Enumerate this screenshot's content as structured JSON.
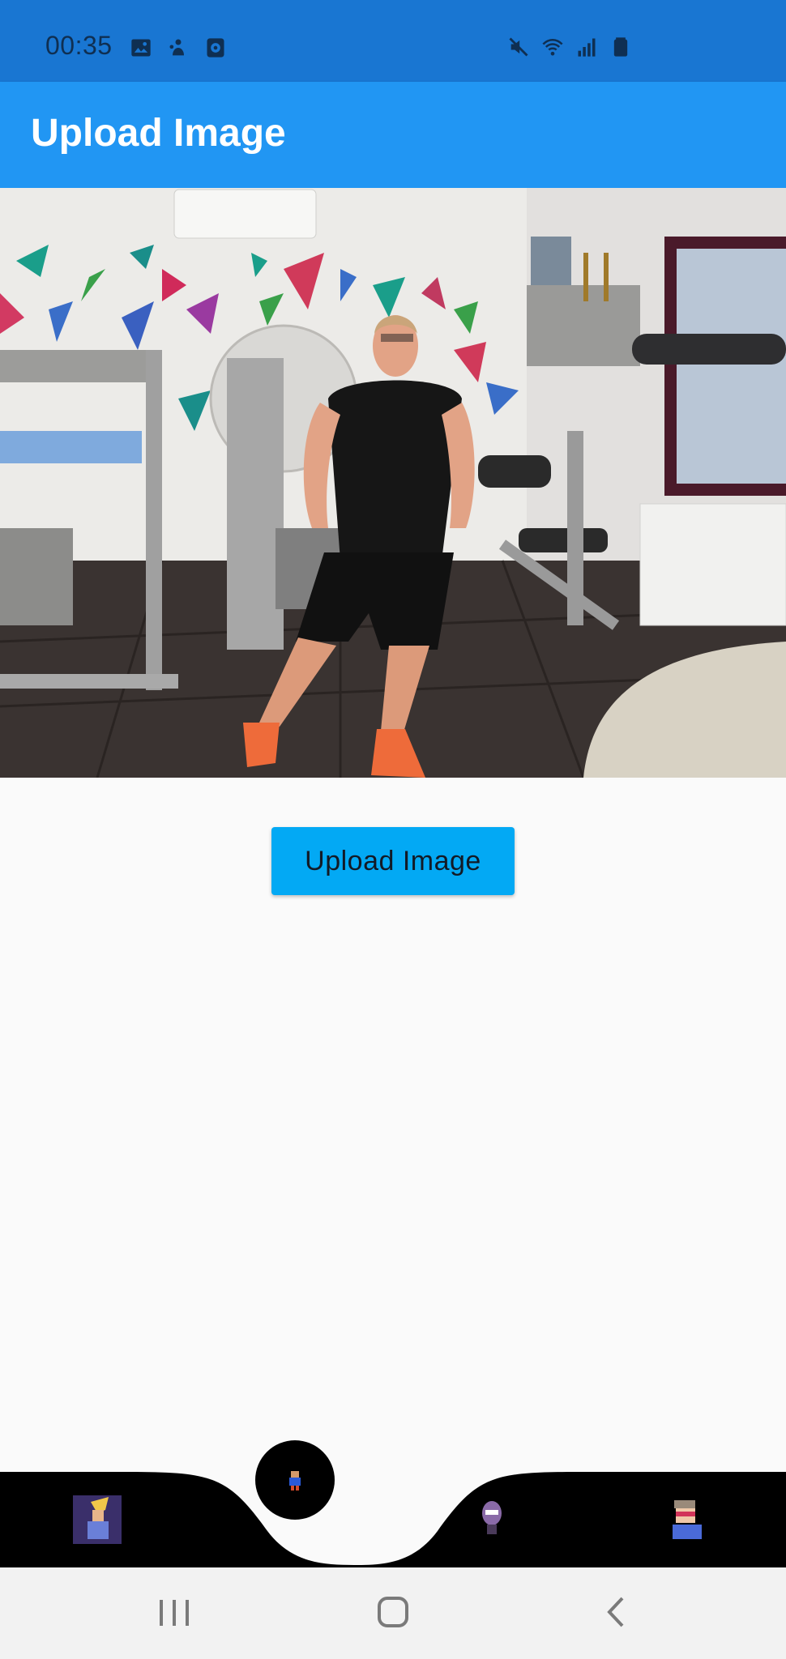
{
  "status_bar": {
    "time": "00:35",
    "left_icons": [
      "image-icon",
      "pet-icon",
      "app-icon"
    ],
    "right_icons": [
      "mute-icon",
      "wifi-icon",
      "signal-icon",
      "battery-icon"
    ],
    "background": "#1976d2"
  },
  "app_bar": {
    "title": "Upload Image",
    "background": "#2196f3"
  },
  "main": {
    "photo_label": "uploaded-gym-photo",
    "upload_button_label": "Upload Image",
    "upload_button_color": "#03a9f4"
  },
  "bottom_nav": {
    "items": [
      {
        "name": "avatar-warrior-icon",
        "position": "left"
      },
      {
        "name": "avatar-pixel-hero-icon",
        "position": "center",
        "selected": true
      },
      {
        "name": "avatar-masked-figure-icon",
        "position": "right"
      },
      {
        "name": "avatar-sunglasses-icon",
        "position": "far-right"
      }
    ]
  },
  "system_nav": {
    "items": [
      "recent-apps-icon",
      "home-icon",
      "back-icon"
    ]
  }
}
